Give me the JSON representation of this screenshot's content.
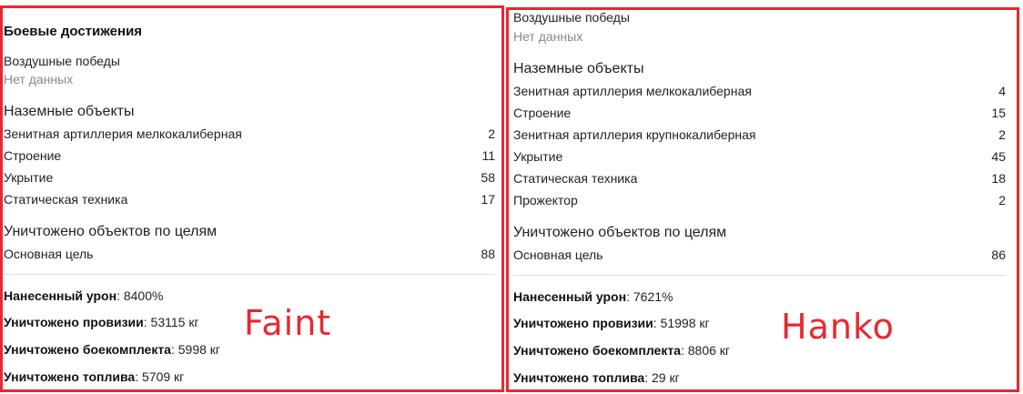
{
  "left": {
    "title": "Боевые достижения",
    "air": {
      "title": "Воздушные победы",
      "empty": "Нет данных"
    },
    "ground": {
      "title": "Наземные объекты",
      "items": [
        {
          "label": "Зенитная артиллерия мелкокалиберная",
          "value": "2"
        },
        {
          "label": "Строение",
          "value": "11"
        },
        {
          "label": "Укрытие",
          "value": "58"
        },
        {
          "label": "Статическая техника",
          "value": "17"
        }
      ]
    },
    "targets": {
      "title": "Уничтожено объектов по целям",
      "items": [
        {
          "label": "Основная цель",
          "value": "88"
        }
      ]
    },
    "stats": [
      {
        "label": "Нанесенный урон",
        "value": ": 8400%"
      },
      {
        "label": "Уничтожено провизии",
        "value": ": 53115 кг"
      },
      {
        "label": "Уничтожено боекомплекта",
        "value": ": 5998 кг"
      },
      {
        "label": "Уничтожено топлива",
        "value": ": 5709 кг"
      }
    ],
    "overlay": "Faint"
  },
  "right": {
    "air": {
      "title": "Воздушные победы",
      "empty": "Нет данных"
    },
    "ground": {
      "title": "Наземные объекты",
      "items": [
        {
          "label": "Зенитная артиллерия мелкокалиберная",
          "value": "4"
        },
        {
          "label": "Строение",
          "value": "15"
        },
        {
          "label": "Зенитная артиллерия крупнокалиберная",
          "value": "2"
        },
        {
          "label": "Укрытие",
          "value": "45"
        },
        {
          "label": "Статическая техника",
          "value": "18"
        },
        {
          "label": "Прожектор",
          "value": "2"
        }
      ]
    },
    "targets": {
      "title": "Уничтожено объектов по целям",
      "items": [
        {
          "label": "Основная цель",
          "value": "86"
        }
      ]
    },
    "stats": [
      {
        "label": "Нанесенный урон",
        "value": ": 7621%"
      },
      {
        "label": "Уничтожено провизии",
        "value": ": 51998 кг"
      },
      {
        "label": "Уничтожено боекомплекта",
        "value": ": 8806 кг"
      },
      {
        "label": "Уничтожено топлива",
        "value": ": 29 кг"
      }
    ],
    "overlay": "Hanko"
  },
  "colors": {
    "annotation_red": "#e8282f",
    "muted_text": "#888888"
  }
}
